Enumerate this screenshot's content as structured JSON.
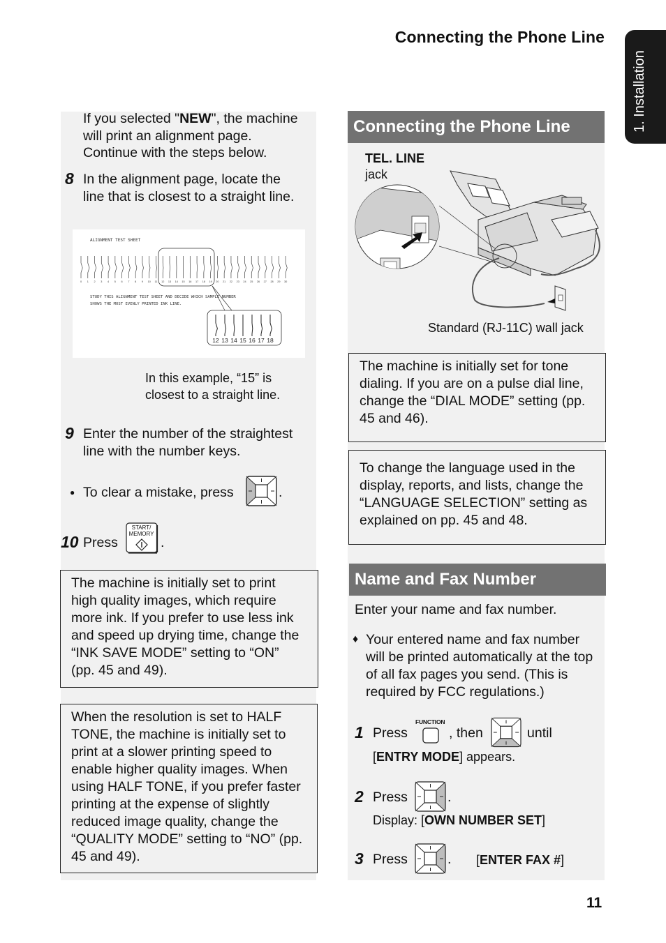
{
  "header": {
    "title": "Connecting the Phone Line"
  },
  "side_tab": {
    "label": "1. Installation"
  },
  "left_column": {
    "intro": {
      "pre": "If you selected \"",
      "bold": "NEW",
      "post_line1": "\", the machine",
      "line2": "will print an alignment page.",
      "line3": "Continue with the steps below."
    },
    "step8": {
      "number": "8",
      "line1": "In the alignment page, locate the",
      "line2": "line that is closest to a straight line."
    },
    "figure": {
      "title": "ALIGNMENT TEST SHEET",
      "scale_numbers": [
        "0",
        "1",
        "2",
        "3",
        "4",
        "5",
        "6",
        "7",
        "8",
        "9",
        "10",
        "11",
        "12",
        "13",
        "14",
        "15",
        "16",
        "17",
        "18",
        "19",
        "20",
        "21",
        "22",
        "23",
        "24",
        "25",
        "26",
        "27",
        "28",
        "29",
        "30"
      ],
      "instruction_line1": "STUDY THIS ALIGNMENT TEST SHEET AND DECIDE WHICH SAMPLE NUMBER",
      "instruction_line2": "SHOWS THE MOST EVENLY PRINTED INK LINE.",
      "magnified_numbers": [
        "12",
        "13",
        "14",
        "15",
        "16",
        "17",
        "18"
      ],
      "straightest": "15"
    },
    "caption": {
      "line1": "In this example, “15” is",
      "line2": "closest to a straight line."
    },
    "step9": {
      "number": "9",
      "line1": "Enter the number of the straightest",
      "line2": "line with the number keys."
    },
    "bullet_clear": {
      "bullet": "●",
      "text": "To clear a mistake, press",
      "end": "."
    },
    "step10": {
      "number": "10",
      "text": "Press",
      "end": ".",
      "key_line1": "START/",
      "key_line2": "MEMORY"
    },
    "note1": [
      "The machine is initially set to print",
      "high quality images, which require",
      "more ink. If you prefer to use less ink",
      "and speed up drying time, change the",
      "“INK SAVE MODE” setting to “ON”",
      "(pp. 45 and 49)."
    ],
    "note2": [
      "When the resolution is set to HALF",
      "TONE, the machine is initially set to",
      "print at a slower printing speed to",
      "enable higher quality images. When",
      "using HALF TONE, if you prefer faster",
      "printing at the expense of slightly",
      "reduced image quality, change the",
      "“QUALITY MODE” setting to “NO” (pp.",
      "45 and 49)."
    ]
  },
  "right_column": {
    "section1": {
      "title": "Connecting the Phone Line",
      "figure": {
        "label_bold": "TEL. LINE",
        "label_sub": "jack",
        "caption": "Standard (RJ-11C) wall jack"
      }
    },
    "note1": [
      "The machine is initially set for tone",
      "dialing. If you are on a pulse dial line,",
      "change the “DIAL MODE” setting (pp.",
      "45 and 46)."
    ],
    "note2": [
      "To change the language used in the",
      "display, reports, and lists, change the",
      "“LANGUAGE SELECTION” setting as",
      "explained on pp. 45 and 48."
    ],
    "section2": {
      "title": "Name and Fax Number",
      "intro": "Enter your name and fax number.",
      "bullet": {
        "symbol": "♦",
        "lines": [
          "Your entered name and fax number",
          "will be printed automatically at the top",
          "of all fax pages you send. (This is",
          "required by FCC regulations.)"
        ]
      },
      "step1": {
        "number": "1",
        "press": "Press",
        "function_label": "FUNCTION",
        "then": ", then",
        "until": "until",
        "open": "[",
        "bold": "ENTRY MODE",
        "close": "] appears."
      },
      "step2": {
        "number": "2",
        "press": "Press",
        "end": ".",
        "display_pre": "Display: [",
        "display_bold": "OWN NUMBER SET",
        "display_post": "]"
      },
      "step3": {
        "number": "3",
        "press": "Press",
        "end": ".",
        "display_open": "[",
        "display_bold": "ENTER FAX #",
        "display_close": "]"
      }
    }
  },
  "footer": {
    "page_number": "11"
  }
}
